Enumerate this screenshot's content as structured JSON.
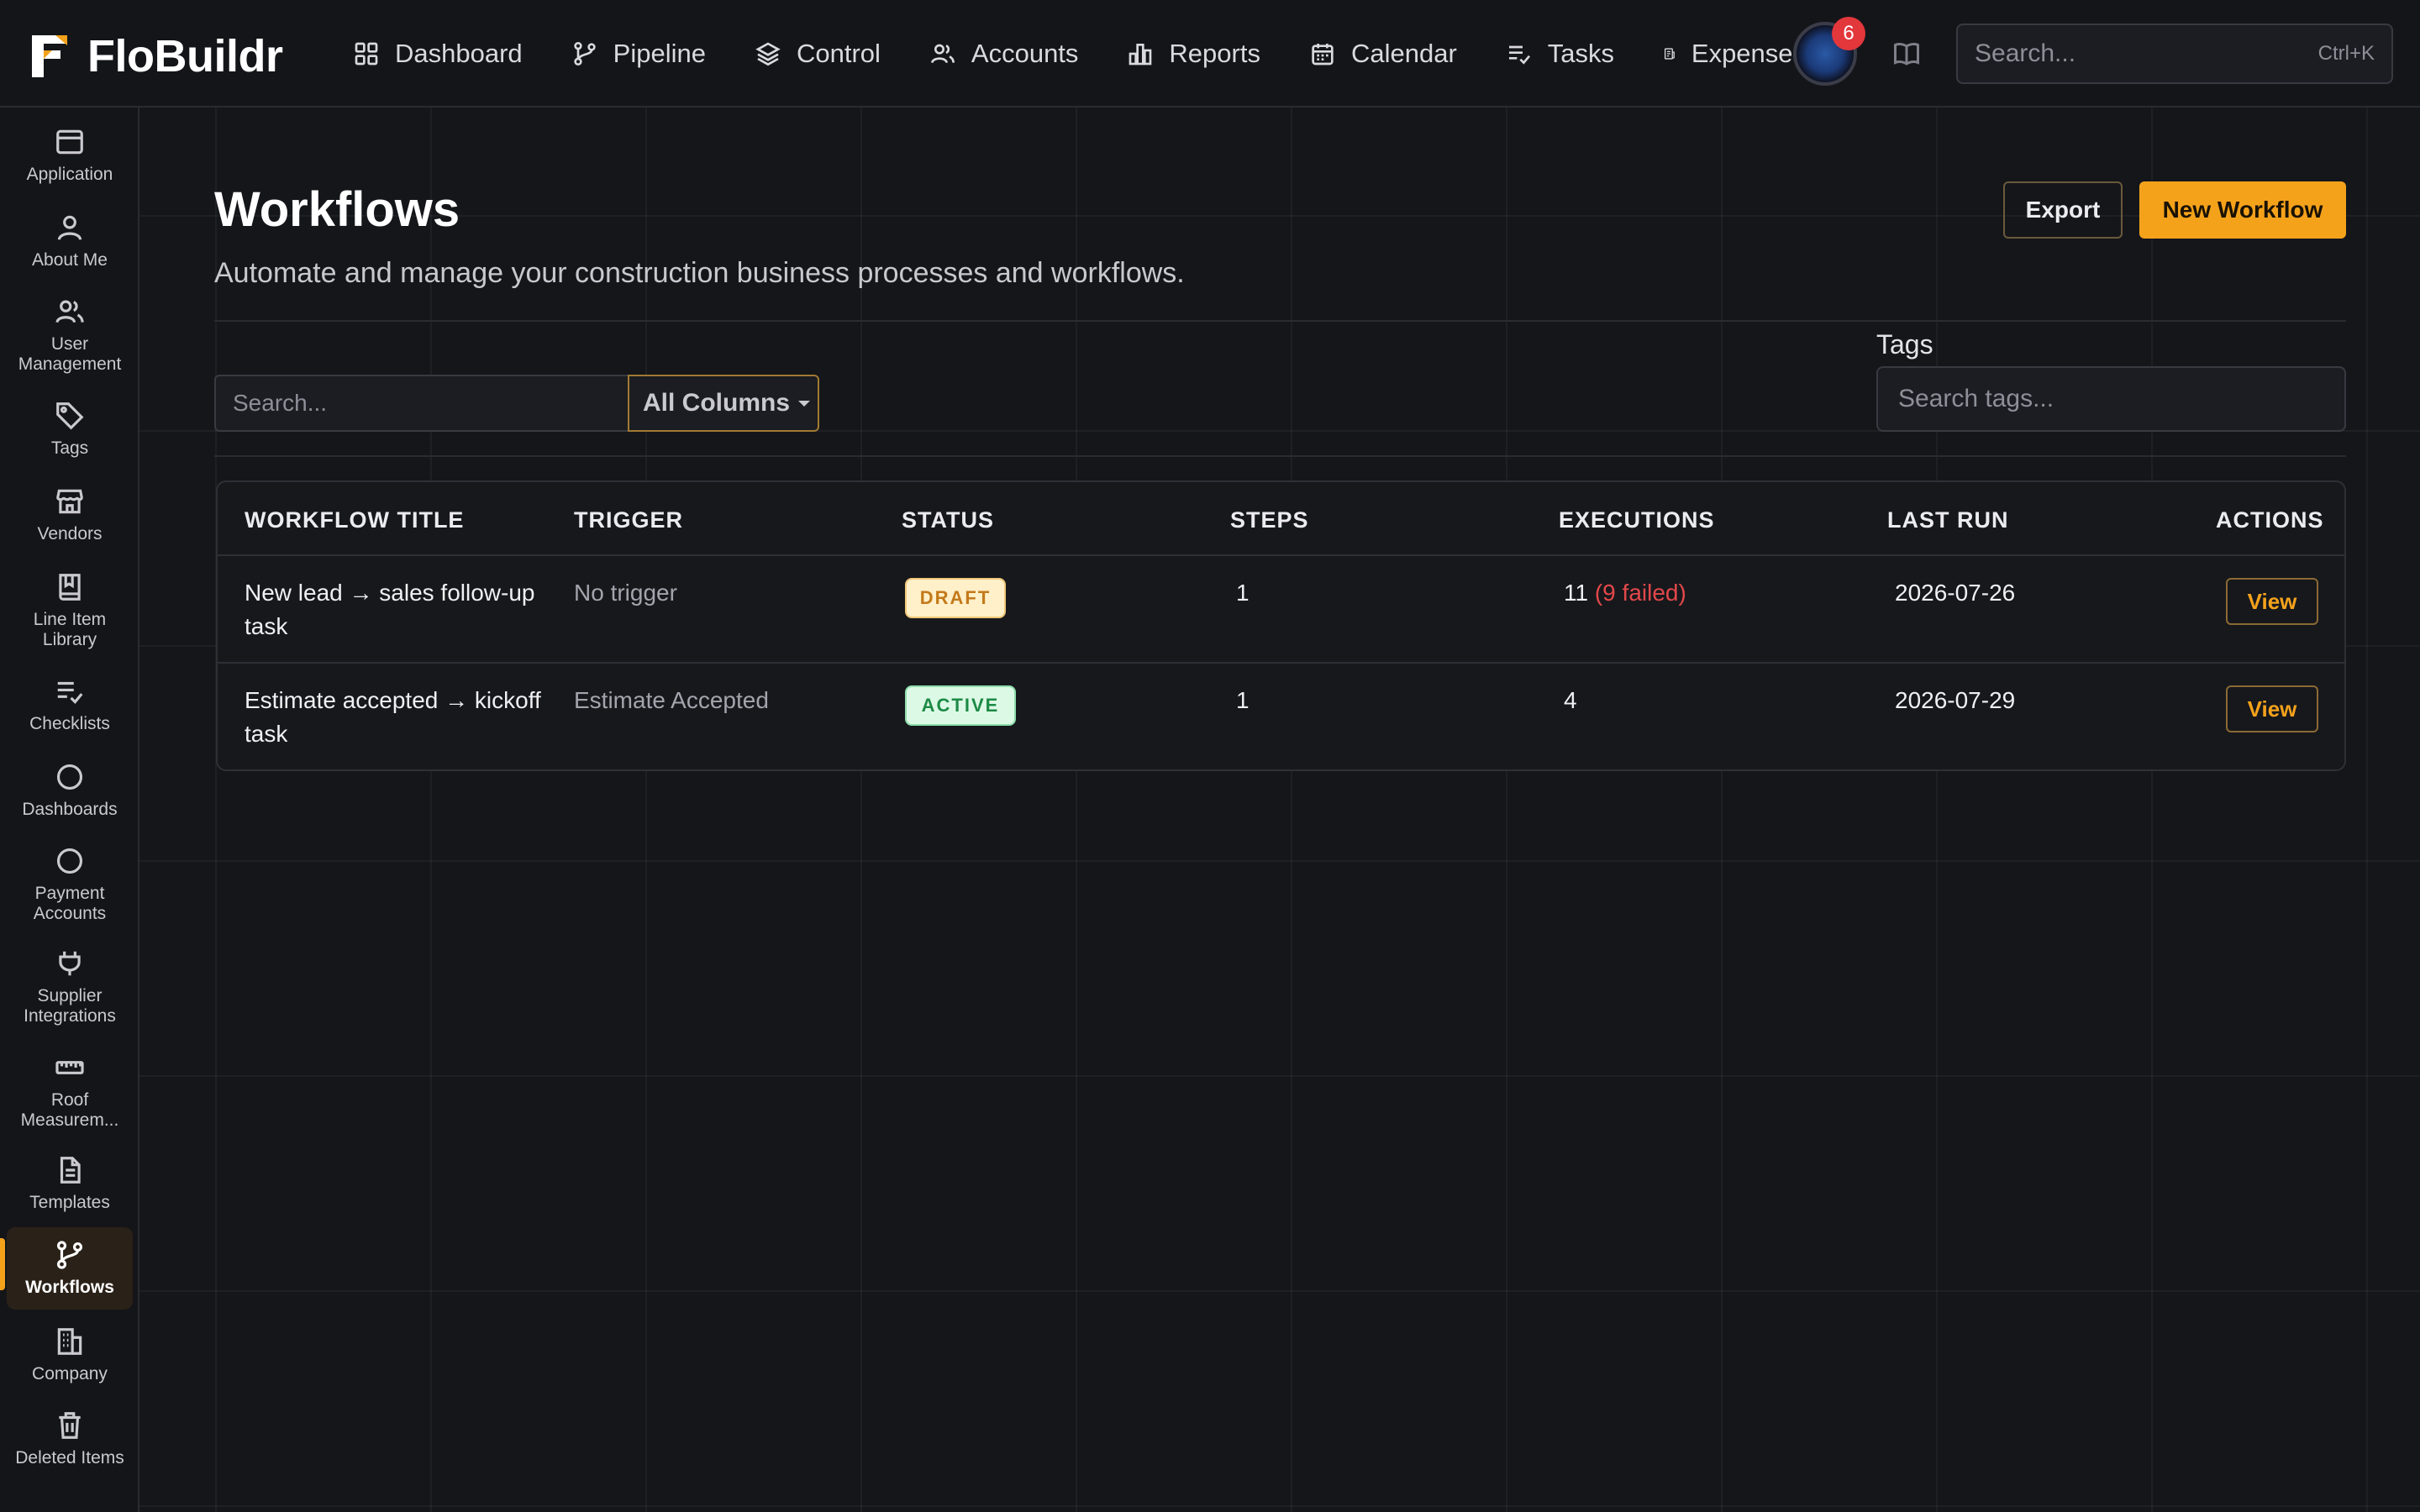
{
  "app": {
    "name": "FloBuildr",
    "colors": {
      "accent": "#f5a21b",
      "background": "#15161a",
      "danger": "#e2373b"
    }
  },
  "topnav": {
    "items": [
      {
        "label": "Dashboard",
        "icon": "grid-icon"
      },
      {
        "label": "Pipeline",
        "icon": "branch-icon"
      },
      {
        "label": "Control",
        "icon": "layers-icon"
      },
      {
        "label": "Accounts",
        "icon": "users-icon"
      },
      {
        "label": "Reports",
        "icon": "bar-chart-icon"
      },
      {
        "label": "Calendar",
        "icon": "calendar-icon"
      },
      {
        "label": "Tasks",
        "icon": "list-check-icon"
      },
      {
        "label": "Expenses",
        "icon": "receipt-icon"
      }
    ],
    "notification_count": "6",
    "search": {
      "placeholder": "Search...",
      "shortcut": "Ctrl+K"
    }
  },
  "sidebar": {
    "items": [
      {
        "label": "Application",
        "icon": "browser-window-icon"
      },
      {
        "label": "About Me",
        "icon": "user-icon"
      },
      {
        "label": "User Management",
        "icon": "users-icon"
      },
      {
        "label": "Tags",
        "icon": "tag-icon"
      },
      {
        "label": "Vendors",
        "icon": "store-icon"
      },
      {
        "label": "Line Item Library",
        "icon": "book-icon"
      },
      {
        "label": "Checklists",
        "icon": "list-check-icon"
      },
      {
        "label": "Dashboards",
        "icon": "circle-icon"
      },
      {
        "label": "Payment Accounts",
        "icon": "circle-icon"
      },
      {
        "label": "Supplier Integrations",
        "icon": "plug-icon"
      },
      {
        "label": "Roof Measurem...",
        "icon": "ruler-icon"
      },
      {
        "label": "Templates",
        "icon": "document-icon"
      },
      {
        "label": "Workflows",
        "icon": "branch-icon",
        "active": true
      },
      {
        "label": "Company",
        "icon": "building-icon"
      },
      {
        "label": "Deleted Items",
        "icon": "trash-icon"
      }
    ]
  },
  "page": {
    "title": "Workflows",
    "subtitle": "Automate and manage your construction business processes and workflows.",
    "export_label": "Export",
    "new_label": "New Workflow"
  },
  "filters": {
    "search_placeholder": "Search...",
    "column_select": "All Columns",
    "tags_label": "Tags",
    "tags_placeholder": "Search tags..."
  },
  "table": {
    "columns": [
      "WORKFLOW TITLE",
      "TRIGGER",
      "STATUS",
      "STEPS",
      "EXECUTIONS",
      "LAST RUN",
      "ACTIONS"
    ],
    "rows": [
      {
        "title": "New lead → sales follow-up task",
        "trigger": "No trigger",
        "status": "DRAFT",
        "steps": "1",
        "executions": "11",
        "failed": "(9 failed)",
        "last_run": "2026-07-26",
        "action": "View"
      },
      {
        "title": "Estimate accepted → kickoff task",
        "trigger": "Estimate Accepted",
        "status": "ACTIVE",
        "steps": "1",
        "executions": "4",
        "failed": "",
        "last_run": "2026-07-29",
        "action": "View"
      }
    ]
  }
}
